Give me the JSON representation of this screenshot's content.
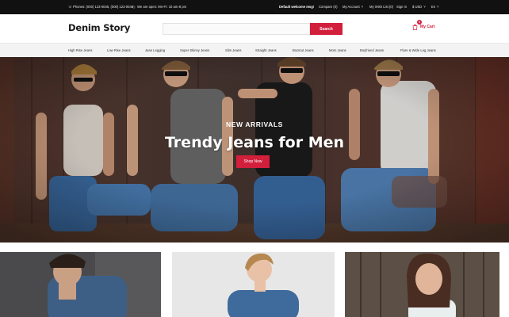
{
  "topbar": {
    "phone": "Phones: (000) 123-0045, (000) 123-0046",
    "hours": "We are open: Mn-Fr: 10 am-8 pm",
    "welcome": "Default welcome msg!",
    "compare": "Compare (0)",
    "my_account": "My Account",
    "wish_list": "My Wish List (0)",
    "sign_in": "Sign In",
    "currency": "$ USD",
    "language": "En"
  },
  "header": {
    "logo": "Denim Story",
    "search_placeholder": "",
    "search_button": "Search",
    "cart_label": "My Cart",
    "cart_count": "0"
  },
  "nav": {
    "items": [
      "High Rise Jeans",
      "Low Rise Jeans",
      "Jean Legging",
      "Super Skinny Jeans",
      "Slim Jeans",
      "Straight Jeans",
      "Bootcut Jeans",
      "Mom Jeans",
      "Boyfriend Jeans",
      "Flare & Wide Leg Jeans"
    ]
  },
  "hero": {
    "subtitle": "NEW ARRIVALS",
    "title": "Trendy Jeans for Men",
    "button": "Shop Now"
  },
  "colors": {
    "accent": "#d21f3c",
    "topbar": "#111111",
    "nav_bg": "#f3f3f3"
  }
}
